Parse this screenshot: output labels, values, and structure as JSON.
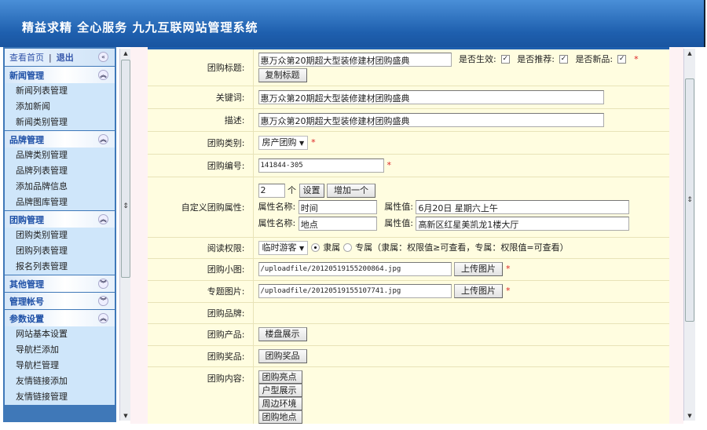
{
  "header": {
    "title": "精益求精 全心服务  九九互联网站管理系统"
  },
  "sidebar": {
    "home": "查看首页",
    "sep": "|",
    "logout": "退出",
    "sections": [
      {
        "title": "新闻管理",
        "expanded": true,
        "items": [
          "新闻列表管理",
          "添加新闻",
          "新闻类别管理"
        ]
      },
      {
        "title": "品牌管理",
        "expanded": true,
        "items": [
          "品牌类别管理",
          "品牌列表管理",
          "添加品牌信息",
          "品牌图库管理"
        ]
      },
      {
        "title": "团购管理",
        "expanded": true,
        "items": [
          "团购类别管理",
          "团购列表管理",
          "报名列表管理"
        ]
      },
      {
        "title": "其他管理",
        "expanded": false,
        "items": []
      },
      {
        "title": "管理帐号",
        "expanded": false,
        "items": []
      },
      {
        "title": "参数设置",
        "expanded": true,
        "items": [
          "网站基本设置",
          "导航栏添加",
          "导航栏管理",
          "友情链接添加",
          "友情链接管理"
        ]
      }
    ]
  },
  "form": {
    "title_label": "团购标题:",
    "title_value": "惠万众第20期超大型装修建材团购盛典",
    "copy_title": "复制标题",
    "active_label": "是否生效:",
    "recommend_label": "是否推荐:",
    "new_label": "是否新品:",
    "check": "✓",
    "keywords_label": "关键词:",
    "keywords_value": "惠万众第20期超大型装修建材团购盛典",
    "desc_label": "描述:",
    "desc_value": "惠万众第20期超大型装修建材团购盛典",
    "category_label": "团购类别:",
    "category_value": "房产团购",
    "code_label": "团购编号:",
    "code_value": "141844-305",
    "custom_label": "自定义团购属性:",
    "count_value": "2",
    "count_unit": "个",
    "set_btn": "设置",
    "add_btn": "增加一个",
    "attr_name_label": "属性名称:",
    "attr_value_label": "属性值:",
    "attrs": [
      {
        "name": "时间",
        "value": "6月20日 星期六上午"
      },
      {
        "name": "地点",
        "value": "高新区红星美凯龙1楼大厅"
      }
    ],
    "perm_label": "阅读权限:",
    "perm_value": "临时游客",
    "perm_opt1": "隶属",
    "perm_opt2": "专属（隶属：权限值≥可查看，专属：权限值=可查看）",
    "small_img_label": "团购小图:",
    "small_img_value": "/uploadfile/20120519155200864.jpg",
    "topic_img_label": "专题图片:",
    "topic_img_value": "/uploadfile/20120519155107741.jpg",
    "upload_btn": "上传图片",
    "brand_label": "团购品牌:",
    "product_label": "团购产品:",
    "product_btn": "楼盘展示",
    "prize_label": "团购奖品:",
    "prize_btn": "团购奖品",
    "content_label": "团购内容:",
    "content_btns": [
      "团购亮点",
      "户型展示",
      "周边环境",
      "团购地点"
    ],
    "required": "*"
  }
}
